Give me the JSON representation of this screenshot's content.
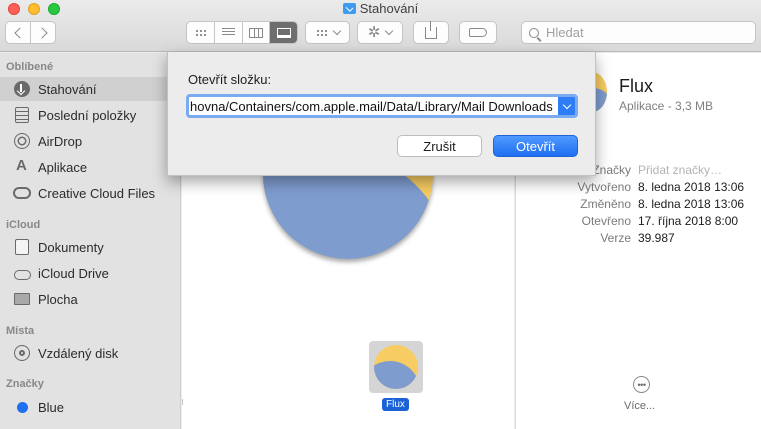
{
  "window": {
    "title": "Stahování"
  },
  "toolbar": {
    "search_placeholder": "Hledat",
    "view_modes": [
      "icon-view",
      "list-view",
      "column-view",
      "gallery-view"
    ],
    "active_view": "gallery-view"
  },
  "sidebar": {
    "sections": [
      {
        "header": "Oblíbené",
        "items": [
          {
            "label": "Stahování",
            "icon": "download-icon",
            "selected": true
          },
          {
            "label": "Poslední položky",
            "icon": "recents-icon"
          },
          {
            "label": "AirDrop",
            "icon": "airdrop-icon"
          },
          {
            "label": "Aplikace",
            "icon": "applications-icon"
          },
          {
            "label": "Creative Cloud Files",
            "icon": "creative-cloud-icon"
          }
        ]
      },
      {
        "header": "iCloud",
        "items": [
          {
            "label": "Dokumenty",
            "icon": "document-icon"
          },
          {
            "label": "iCloud Drive",
            "icon": "cloud-icon"
          },
          {
            "label": "Plocha",
            "icon": "desktop-icon"
          }
        ]
      },
      {
        "header": "Místa",
        "items": [
          {
            "label": "Vzdálený disk",
            "icon": "disk-icon"
          }
        ]
      },
      {
        "header": "Značky",
        "items": [
          {
            "label": "Blue",
            "icon": "tag-icon",
            "color": "#1f6ff0"
          }
        ]
      }
    ]
  },
  "main": {
    "selected_file": "Flux"
  },
  "info": {
    "name": "Flux",
    "kind": "Aplikace - 3,3 MB",
    "meta": [
      {
        "key": "Značky",
        "value": "Přidat značky…",
        "placeholder": true
      },
      {
        "key": "Vytvořeno",
        "value": "8. ledna 2018 13:06"
      },
      {
        "key": "Změněno",
        "value": "8. ledna 2018 13:06"
      },
      {
        "key": "Otevřeno",
        "value": "17. října 2018 8:00"
      },
      {
        "key": "Verze",
        "value": "39.987"
      }
    ],
    "more_label": "Více..."
  },
  "dialog": {
    "title": "Otevřít složku:",
    "path_value": "hovna/Containers/com.apple.mail/Data/Library/Mail Downloads",
    "cancel_label": "Zrušit",
    "open_label": "Otevřít"
  },
  "colors": {
    "accent": "#1f6ff0",
    "tag_blue": "#1f6ff0"
  }
}
